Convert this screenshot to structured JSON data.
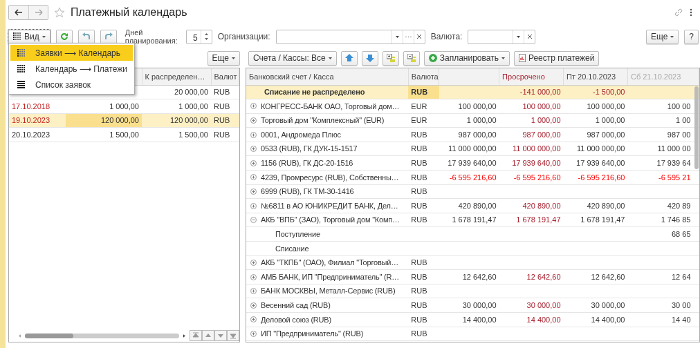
{
  "window": {
    "title": "Платежный календарь"
  },
  "toolbar": {
    "view_button": "Вид",
    "days_label": "Дней планирования:",
    "days_value": "5",
    "org_label": "Организации:",
    "currency_label": "Валюта:",
    "more_button": "Еще",
    "help_button": "?"
  },
  "view_menu": [
    {
      "label": "Заявки ⟶ Календарь",
      "selected": true
    },
    {
      "label": "Календарь ⟶ Платежи",
      "selected": false
    },
    {
      "label": "Список заявок",
      "selected": false
    }
  ],
  "requests": {
    "more_button": "Еще",
    "columns": [
      "К распределен…",
      "Валют"
    ],
    "rows": [
      {
        "to_distribute": "20 000,00",
        "currency": "RUB",
        "selected": false
      },
      {
        "date": "17.10.2018",
        "amount": "1 000,00",
        "to_distribute": "1 000,00",
        "currency": "RUB",
        "overdue": true,
        "selected": false
      },
      {
        "date": "19.10.2023",
        "amount": "120 000,00",
        "to_distribute": "120 000,00",
        "currency": "RUB",
        "overdue": true,
        "selected": true
      },
      {
        "date": "20.10.2023",
        "amount": "1 500,00",
        "to_distribute": "1 500,00",
        "currency": "RUB",
        "overdue": false,
        "selected": false
      }
    ]
  },
  "accounts": {
    "filter_button": "Счета / Кассы: Все",
    "plan_button": "Запланировать",
    "registry_button": "Реестр платежей",
    "columns": [
      {
        "kind": "name",
        "label": "Банковский счет / Касса"
      },
      {
        "kind": "currency",
        "label": "Валюта"
      },
      {
        "kind": "column_3"
      },
      {
        "kind": "overdue",
        "label": "Просрочено"
      },
      {
        "kind": "day",
        "label": "Пт 20.10.2023"
      },
      {
        "kind": "day_off",
        "label": "Сб 21.10.2023"
      }
    ],
    "rows": [
      {
        "kind": "total",
        "name": "Списание не распределено",
        "currency": "RUB",
        "amounts": {
          "overdue": "-141 000,00",
          "day": "-1 500,00"
        },
        "negative": false,
        "selected": true
      },
      {
        "kind": "account",
        "name": "КОНГРЕСС-БАНК ОАО, Торговый дом…",
        "currency": "EUR",
        "amounts": {
          "column_3": "100 000,00",
          "overdue": "100 000,00",
          "day": "100 000,00",
          "day_off": "100 00"
        },
        "negative": false,
        "selected": false,
        "expanded": false
      },
      {
        "kind": "account",
        "name": "Торговый дом \"Комплексный\" (EUR)",
        "currency": "EUR",
        "amounts": {
          "column_3": "1 000,00",
          "overdue": "1 000,00",
          "day": "1 000,00",
          "day_off": "1 00"
        },
        "negative": false,
        "selected": false,
        "expanded": false
      },
      {
        "kind": "account",
        "name": "0001, Андромеда Плюс",
        "currency": "RUB",
        "amounts": {
          "column_3": "987 000,00",
          "overdue": "987 000,00",
          "day": "987 000,00",
          "day_off": "987 00"
        },
        "negative": false,
        "selected": false,
        "expanded": false
      },
      {
        "kind": "account",
        "name": "0533 (RUB), ГК ДУК-15-1517",
        "currency": "RUB",
        "amounts": {
          "column_3": "11 000 000,00",
          "overdue": "11 000 000,00",
          "day": "11 000 000,00",
          "day_off": "11 000 00"
        },
        "negative": false,
        "selected": false,
        "expanded": false
      },
      {
        "kind": "account",
        "name": "1156 (RUB), ГК ДС-20-1516",
        "currency": "RUB",
        "amounts": {
          "column_3": "17 939 640,00",
          "overdue": "17 939 640,00",
          "day": "17 939 640,00",
          "day_off": "17 939 64"
        },
        "negative": false,
        "selected": false,
        "expanded": false
      },
      {
        "kind": "account",
        "name": "4239, Промресурс (RUB), Собственны…",
        "currency": "RUB",
        "amounts": {
          "column_3": "-6 595 216,60",
          "overdue": "-6 595 216,60",
          "day": "-6 595 216,60",
          "day_off": "-6 595 21"
        },
        "negative": true,
        "selected": false,
        "expanded": false
      },
      {
        "kind": "account",
        "name": "6999 (RUB), ГК ТМ-30-1416",
        "currency": "RUB",
        "selected": false,
        "expanded": false
      },
      {
        "kind": "account",
        "name": "№6811 в АО ЮНИКРЕДИТ БАНК, Дел…",
        "currency": "RUB",
        "amounts": {
          "column_3": "420 890,00",
          "overdue": "420 890,00",
          "day": "420 890,00",
          "day_off": "420 89"
        },
        "negative": false,
        "selected": false,
        "expanded": false
      },
      {
        "kind": "account",
        "name": "АКБ \"ВПБ\" (ЗАО), Торговый дом \"Комп…",
        "currency": "RUB",
        "amounts": {
          "column_3": "1 678 191,47",
          "overdue": "1 678 191,47",
          "day": "1 678 191,47",
          "day_off": "1 746 85"
        },
        "negative": false,
        "selected": false,
        "expanded": true,
        "children": [
          {
            "kind": "item",
            "name": "Поступление",
            "amounts": {
              "day_off": "68 65"
            },
            "negative": false,
            "selected": false
          },
          {
            "kind": "item",
            "name": "Списание",
            "selected": false
          }
        ]
      },
      {
        "kind": "account",
        "name": "АКБ \"ТКПБ\" (ОАО), Филиал \"Торговый…",
        "currency": "RUB",
        "selected": false,
        "expanded": false
      },
      {
        "kind": "account",
        "name": "АМБ БАНК, ИП \"Предприниматель\" (R…",
        "currency": "RUB",
        "amounts": {
          "column_3": "12 642,60",
          "overdue": "12 642,60",
          "day": "12 642,60",
          "day_off": "12 64"
        },
        "negative": false,
        "selected": false,
        "expanded": false
      },
      {
        "kind": "account",
        "name": "БАНК МОСКВЫ, Металл-Сервис (RUB)",
        "currency": "RUB",
        "selected": false,
        "expanded": false
      },
      {
        "kind": "account",
        "name": "Весенний сад (RUB)",
        "currency": "RUB",
        "amounts": {
          "column_3": "30 000,00",
          "overdue": "30 000,00",
          "day": "30 000,00",
          "day_off": "30 00"
        },
        "negative": false,
        "selected": false,
        "expanded": false
      },
      {
        "kind": "account",
        "name": "Деловой союз (RUB)",
        "currency": "RUB",
        "amounts": {
          "column_3": "14 400,00",
          "overdue": "14 400,00",
          "day": "14 400,00",
          "day_off": "14 40"
        },
        "negative": false,
        "selected": false,
        "expanded": false
      },
      {
        "kind": "account",
        "name": "ИП \"Предприниматель\" (RUB)",
        "currency": "RUB",
        "selected": false,
        "expanded": false
      }
    ]
  }
}
